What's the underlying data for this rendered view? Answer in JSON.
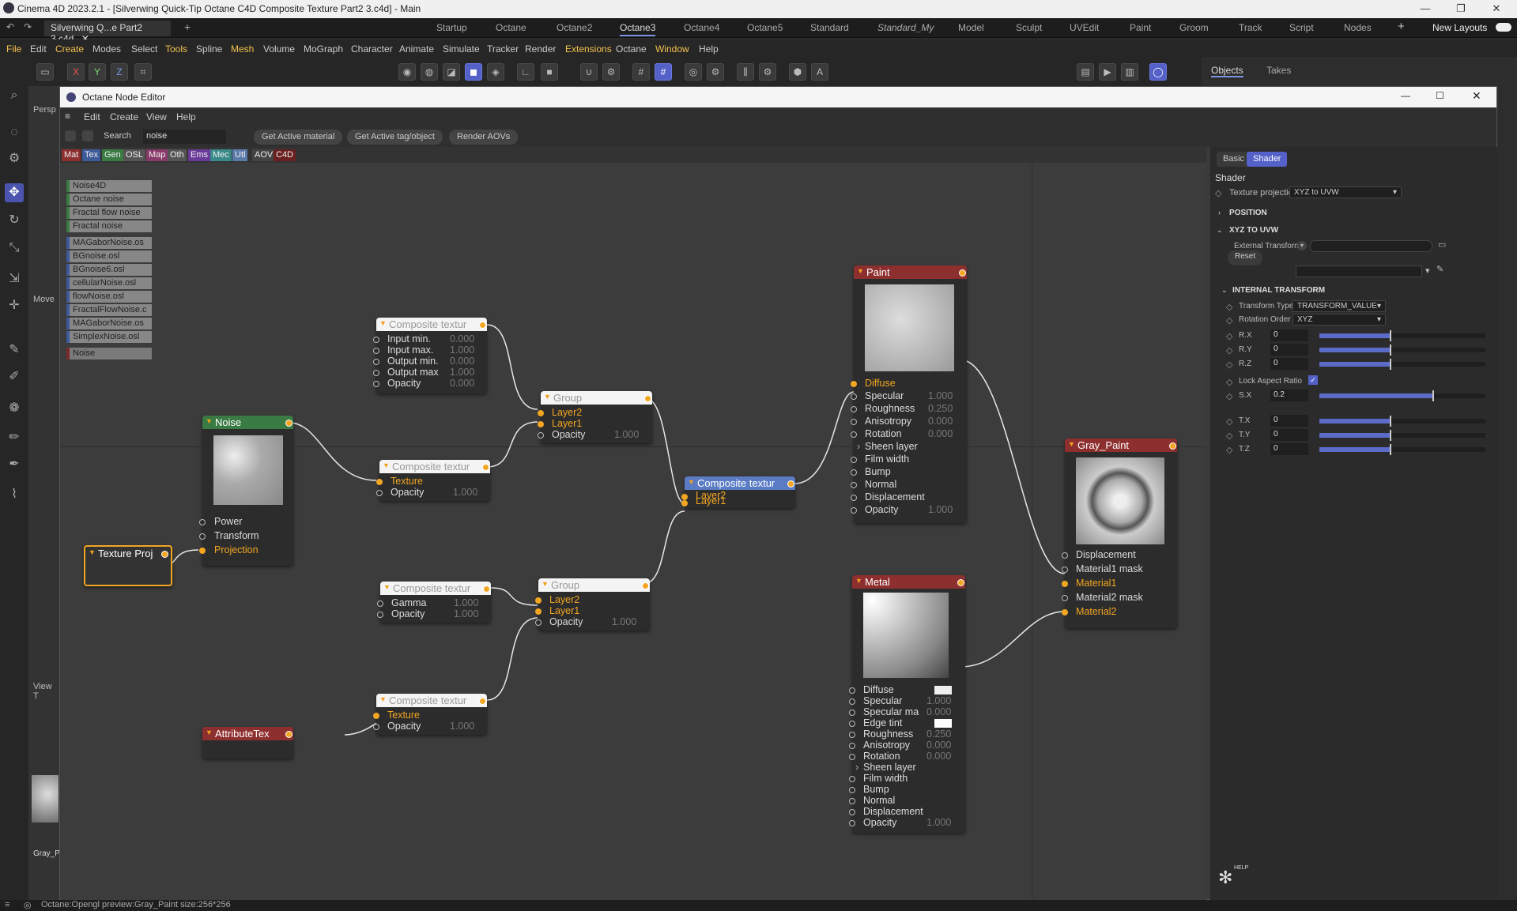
{
  "window": {
    "title": "Cinema 4D 2023.2.1 - [Silverwing Quick-Tip Octane C4D Composite Texture Part2 3.c4d] - Main"
  },
  "doc_tab": "Silverwing Q...e Part2 3.c4d",
  "layouts": [
    "Startup",
    "Octane",
    "Octane2",
    "Octane3",
    "Octane4",
    "Octane5",
    "Standard",
    "Standard_My",
    "Model",
    "Sculpt",
    "UVEdit",
    "Paint",
    "Groom",
    "Track",
    "Script",
    "Nodes"
  ],
  "new_layouts": "New Layouts",
  "menu": [
    "File",
    "Edit",
    "Create",
    "Modes",
    "Select",
    "Tools",
    "Spline",
    "Mesh",
    "Volume",
    "MoGraph",
    "Character",
    "Animate",
    "Simulate",
    "Tracker",
    "Render",
    "Extensions",
    "Octane",
    "Window",
    "Help"
  ],
  "axes": {
    "x": "X",
    "y": "Y",
    "z": "Z"
  },
  "right_tabs": {
    "objects": "Objects",
    "takes": "Takes"
  },
  "node_editor": {
    "title": "Octane Node Editor",
    "menu": [
      "Edit",
      "Create",
      "View",
      "Help"
    ],
    "search_label": "Search",
    "search_value": "noise",
    "buttons": [
      "Get Active material",
      "Get Active tag/object",
      "Render AOVs"
    ],
    "categories": [
      "Mat",
      "Tex",
      "Gen",
      "OSL",
      "Map",
      "Oth",
      "Ems",
      "Mec",
      "Utl",
      "AOV",
      "C4D"
    ],
    "list": [
      "Noise4D",
      "Octane noise",
      "Fractal flow noise",
      "Fractal noise",
      "MAGaborNoise.os",
      "BGnoise.osl",
      "BGnoise6.osl",
      "cellularNoise.osl",
      "flowNoise.osl",
      "FractalFlowNoise.c",
      "MAGaborNoise.os",
      "SimplexNoise.osl",
      "Noise"
    ]
  },
  "nodes": {
    "texproj": "Texture Proj",
    "noise": {
      "title": "Noise",
      "pins": [
        "Power",
        "Transform",
        "Projection"
      ]
    },
    "attr": "AttributeTex",
    "comp1": {
      "title": "Composite textur",
      "pins": [
        "Input min.",
        "Input max.",
        "Output min.",
        "Output max",
        "Opacity"
      ],
      "vals": [
        "0.000",
        "1.000",
        "0.000",
        "1.000",
        "0.000"
      ]
    },
    "comp2": {
      "title": "Composite textur",
      "pins": [
        "Texture",
        "Opacity"
      ],
      "vals": [
        "",
        "1.000"
      ]
    },
    "comp3": {
      "title": "Composite textur",
      "pins": [
        "Gamma",
        "Opacity"
      ],
      "vals": [
        "1.000",
        "1.000"
      ]
    },
    "comp4": {
      "title": "Composite textur",
      "pins": [
        "Texture",
        "Opacity"
      ],
      "vals": [
        "",
        "1.000"
      ]
    },
    "group1": {
      "title": "Group",
      "pins": [
        "Layer2",
        "Layer1",
        "Opacity"
      ],
      "vals": [
        "",
        "",
        "1.000"
      ]
    },
    "group2": {
      "title": "Group",
      "pins": [
        "Layer2",
        "Layer1",
        "Opacity"
      ],
      "vals": [
        "",
        "",
        "1.000"
      ]
    },
    "compmain": {
      "title": "Composite textur",
      "pins": [
        "Layer2",
        "Layer1"
      ]
    },
    "paint": {
      "title": "Paint",
      "pins": [
        "Diffuse",
        "Specular",
        "Roughness",
        "Anisotropy",
        "Rotation",
        "Sheen layer",
        "Film width",
        "Bump",
        "Normal",
        "Displacement",
        "Opacity"
      ],
      "vals": [
        "",
        "1.000",
        "0.250",
        "0.000",
        "0.000",
        "",
        "",
        "",
        "",
        "",
        "1.000"
      ]
    },
    "metal": {
      "title": "Metal",
      "pins": [
        "Diffuse",
        "Specular",
        "Specular ma",
        "Edge tint",
        "Roughness",
        "Anisotropy",
        "Rotation",
        "Sheen layer",
        "Film width",
        "Bump",
        "Normal",
        "Displacement",
        "Opacity"
      ],
      "vals": [
        "",
        "1.000",
        "0.000",
        "",
        "0.250",
        "0.000",
        "0.000",
        "",
        "",
        "",
        "",
        "",
        "1.000"
      ]
    },
    "gray": {
      "title": "Gray_Paint",
      "pins": [
        "Displacement",
        "Material1 mask",
        "Material1",
        "Material2 mask",
        "Material2"
      ]
    }
  },
  "props": {
    "tabs": [
      "Basic",
      "Shader"
    ],
    "section": "Shader",
    "texture_projection_label": "Texture projection",
    "texture_projection_value": "XYZ to UVW",
    "position": "POSITION",
    "xyz_to_uvw": "XYZ TO UVW",
    "external_transform": "External Transform",
    "reset": "Reset",
    "internal_transform": "INTERNAL TRANSFORM",
    "transform_type_label": "Transform Type",
    "transform_type_value": "TRANSFORM_VALUE",
    "rotation_order_label": "Rotation Order",
    "rotation_order_value": "XYZ",
    "rx": {
      "label": "R.X",
      "value": "0"
    },
    "ry": {
      "label": "R.Y",
      "value": "0"
    },
    "rz": {
      "label": "R.Z",
      "value": "0"
    },
    "lock": "Lock Aspect Ratio",
    "sx": {
      "label": "S.X",
      "value": "0.2"
    },
    "tx": {
      "label": "T.X",
      "value": "0"
    },
    "ty": {
      "label": "T.Y",
      "value": "0"
    },
    "tz": {
      "label": "T.Z",
      "value": "0"
    },
    "help": "HELP"
  },
  "left_panel": {
    "persp": "Persp",
    "move": "Move",
    "viewt": "View T",
    "gray_p": "Gray_P"
  },
  "status": "Octane:Opengl preview:Gray_Paint  size:256*256"
}
